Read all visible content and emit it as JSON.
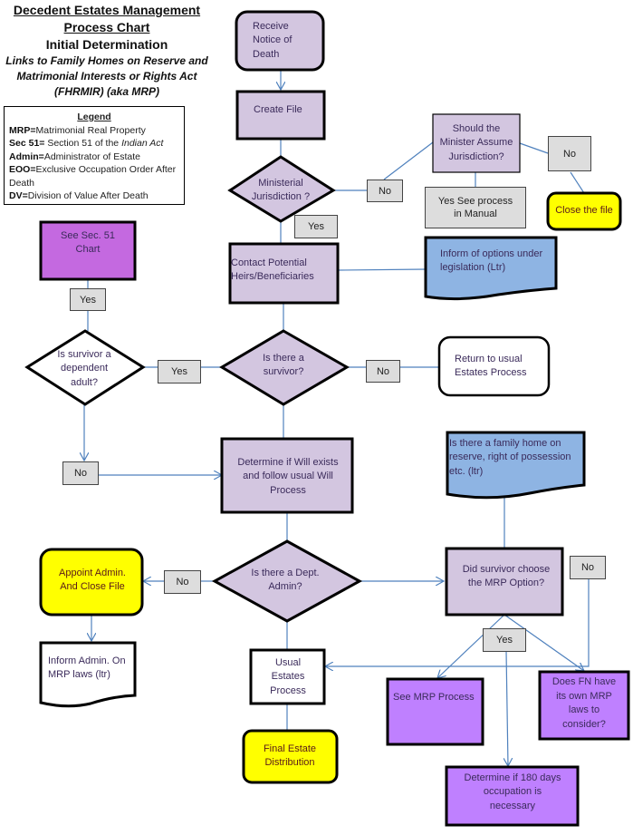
{
  "title": {
    "line1": "Decedent Estates Management",
    "line2": "Process Chart",
    "line3": "Initial Determination",
    "line4": "Links to Family  Homes on Reserve and",
    "line5": "Matrimonial  Interests or Rights  Act",
    "line6": "(FHRMIR) (aka MRP)"
  },
  "legend": {
    "heading": "Legend",
    "items": [
      {
        "term": "MRP",
        "sep": "=",
        "definition": "Matrimonial Real Property"
      },
      {
        "term": "Sec 51",
        "sep": "= ",
        "definition": "Section 51 of the ",
        "definition_italic": "Indian Act"
      },
      {
        "term": "Admin",
        "sep": "=",
        "definition": "Administrator of Estate"
      },
      {
        "term": "EOO",
        "sep": "=",
        "definition": "Exclusive Occupation Order After Death"
      },
      {
        "term": "DV",
        "sep": "=",
        "definition": "Division of Value After Death"
      }
    ]
  },
  "colors": {
    "process_fill": "#d3c6e0",
    "mrp_fill": "#bf80ff",
    "sec51_fill": "#c469e0",
    "terminal_fill": "#ffff00",
    "document_fill": "#8eb4e3",
    "label_fill": "#dddddd",
    "connector": "#4f81bd"
  },
  "nodes": {
    "receive_notice": "Receive Notice of Death",
    "create_file": "Create File",
    "ministerial_jurisdiction": "Ministerial Jurisdiction ?",
    "should_minister": "Should the Minister Assume Jurisdiction?",
    "yes_see_manual": "Yes See process in Manual",
    "close_the_file": "Close the file",
    "contact_heirs": "Contact Potential Heirs/Beneficiaries",
    "inform_options": "Inform of options under legislation (Ltr)",
    "see_sec51": "See Sec. 51 Chart",
    "is_survivor": "Is there a survivor?",
    "is_dependent_adult": "Is survivor a dependent adult?",
    "return_usual": "Return to usual Estates Process",
    "determine_will": "Determine if Will exists and follow usual Will Process",
    "family_home": "Is there a family home on reserve, right of possession etc. (ltr)",
    "dept_admin": "Is there a Dept. Admin?",
    "appoint_admin": "Appoint Admin. And Close File",
    "did_survivor_choose": "Did survivor choose the MRP Option?",
    "inform_admin": "Inform Admin. On MRP laws (ltr)",
    "usual_estates": "Usual Estates Process",
    "see_mrp": "See MRP Process",
    "fn_own_laws": "Does FN have its own MRP laws to consider?",
    "final_distribution": "Final Estate Distribution",
    "determine_180": "Determine if 180 days occupation is necessary"
  },
  "labels": {
    "no_ministerial": "No",
    "yes_ministerial": "Yes",
    "no_should_minister": "No",
    "yes_sec51": "Yes",
    "yes_dependent": "Yes",
    "no_survivor": "No",
    "no_dependent": "No",
    "no_dept_admin": "No",
    "no_mrp_option": "No",
    "yes_mrp_option": "Yes"
  }
}
